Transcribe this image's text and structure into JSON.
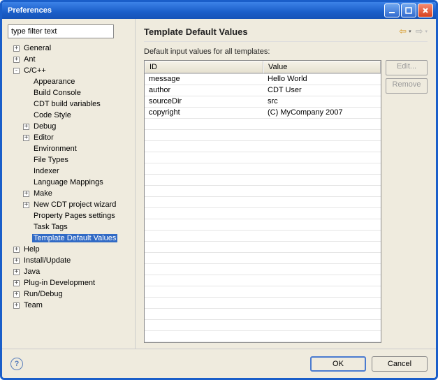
{
  "title": "Preferences",
  "filter_placeholder": "type filter text",
  "tree": {
    "general": "General",
    "ant": "Ant",
    "ccpp": "C/C++",
    "appearance": "Appearance",
    "build_console": "Build Console",
    "cdt_build_vars": "CDT build variables",
    "code_style": "Code Style",
    "debug": "Debug",
    "editor": "Editor",
    "environment": "Environment",
    "file_types": "File Types",
    "indexer": "Indexer",
    "lang_mappings": "Language Mappings",
    "make": "Make",
    "new_cdt_wizard": "New CDT project wizard",
    "property_pages": "Property Pages settings",
    "task_tags": "Task Tags",
    "template_defaults": "Template Default Values",
    "help": "Help",
    "install_update": "Install/Update",
    "java": "Java",
    "plugin_dev": "Plug-in Development",
    "run_debug": "Run/Debug",
    "team": "Team"
  },
  "panel": {
    "title": "Template Default Values",
    "description": "Default input values for all templates:",
    "col_id": "ID",
    "col_value": "Value",
    "rows": [
      {
        "id": "message",
        "value": "Hello World"
      },
      {
        "id": "author",
        "value": "CDT User"
      },
      {
        "id": "sourceDir",
        "value": "src"
      },
      {
        "id": "copyright",
        "value": "(C) MyCompany 2007"
      }
    ],
    "edit": "Edit...",
    "remove": "Remove"
  },
  "footer": {
    "ok": "OK",
    "cancel": "Cancel"
  }
}
